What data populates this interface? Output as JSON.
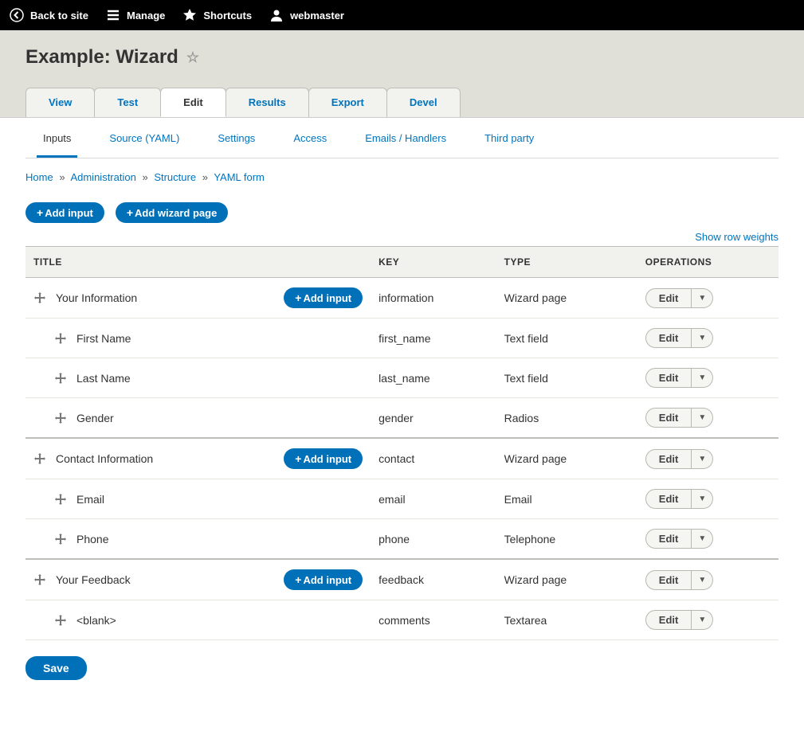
{
  "toolbar": {
    "back": "Back to site",
    "manage": "Manage",
    "shortcuts": "Shortcuts",
    "user": "webmaster"
  },
  "page": {
    "title": "Example: Wizard"
  },
  "tabs_primary": {
    "view": "View",
    "test": "Test",
    "edit": "Edit",
    "results": "Results",
    "export": "Export",
    "devel": "Devel"
  },
  "tabs_secondary": {
    "inputs": "Inputs",
    "source": "Source (YAML)",
    "settings": "Settings",
    "access": "Access",
    "emails": "Emails / Handlers",
    "third": "Third party"
  },
  "breadcrumb": {
    "home": "Home",
    "admin": "Administration",
    "structure": "Structure",
    "yaml": "YAML form"
  },
  "buttons": {
    "add_input": "Add input",
    "add_wizard": "Add wizard page",
    "save": "Save",
    "edit": "Edit"
  },
  "links": {
    "show_weights": "Show row weights"
  },
  "table": {
    "headers": {
      "title": "TITLE",
      "key": "KEY",
      "type": "TYPE",
      "operations": "OPERATIONS"
    },
    "rows": [
      {
        "title": "Your Information",
        "key": "information",
        "type": "Wizard page",
        "section": true
      },
      {
        "title": "First Name",
        "key": "first_name",
        "type": "Text field",
        "indent": true
      },
      {
        "title": "Last Name",
        "key": "last_name",
        "type": "Text field",
        "indent": true
      },
      {
        "title": "Gender",
        "key": "gender",
        "type": "Radios",
        "indent": true
      },
      {
        "title": "Contact Information",
        "key": "contact",
        "type": "Wizard page",
        "section": true
      },
      {
        "title": "Email",
        "key": "email",
        "type": "Email",
        "indent": true
      },
      {
        "title": "Phone",
        "key": "phone",
        "type": "Telephone",
        "indent": true
      },
      {
        "title": "Your Feedback",
        "key": "feedback",
        "type": "Wizard page",
        "section": true
      },
      {
        "title": "<blank>",
        "key": "comments",
        "type": "Textarea",
        "indent": true
      }
    ]
  }
}
